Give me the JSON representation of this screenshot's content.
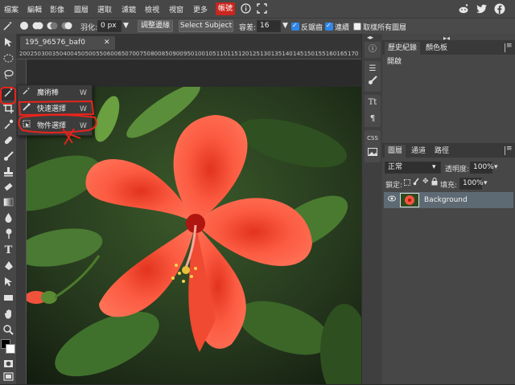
{
  "menu": {
    "items": [
      "檔案",
      "編輯",
      "影像",
      "圖層",
      "選取",
      "濾鏡",
      "檢視",
      "視窗",
      "更多"
    ],
    "account": "帳號"
  },
  "options": {
    "feather_label": "羽化:",
    "feather_value": "0 px",
    "refine_edge": "調整邊緣",
    "select_subject": "Select Subject",
    "tolerance_label": "容差:",
    "tolerance_value": "16",
    "antialias_label": "反鋸齒",
    "contiguous_label": "連續",
    "sample_all_label": "取樣所有圖層",
    "antialias_checked": true,
    "contiguous_checked": true,
    "sample_all_checked": false
  },
  "document": {
    "tab_name": "195_96576_baf0",
    "ruler_marks": [
      "200",
      "250",
      "300",
      "350",
      "400",
      "450",
      "500",
      "550",
      "600",
      "650",
      "700",
      "750",
      "800",
      "850",
      "900",
      "950",
      "100",
      "105",
      "110",
      "115",
      "120",
      "125",
      "130",
      "135",
      "140",
      "145",
      "150",
      "155",
      "160",
      "165",
      "170"
    ]
  },
  "flyout": {
    "items": [
      {
        "label": "魔術棒",
        "key": "W"
      },
      {
        "label": "快速選擇",
        "key": "W"
      },
      {
        "label": "物件選擇",
        "key": "W"
      }
    ]
  },
  "history": {
    "tabs": [
      "歷史紀錄",
      "顏色板"
    ],
    "rows": [
      "開啟"
    ]
  },
  "layers": {
    "tabs": [
      "圖層",
      "通道",
      "路徑"
    ],
    "blend_mode": "正常",
    "opacity_label": "透明度:",
    "opacity_value": "100%",
    "lock_label": "鎖定:",
    "fill_label": "填充:",
    "fill_value": "100%",
    "layer_name": "Background"
  },
  "colors": {
    "accent": "#c8261e",
    "checkbox": "#2f86e8",
    "annotation": "#e8241b",
    "layer_selected": "#5e6a73"
  }
}
